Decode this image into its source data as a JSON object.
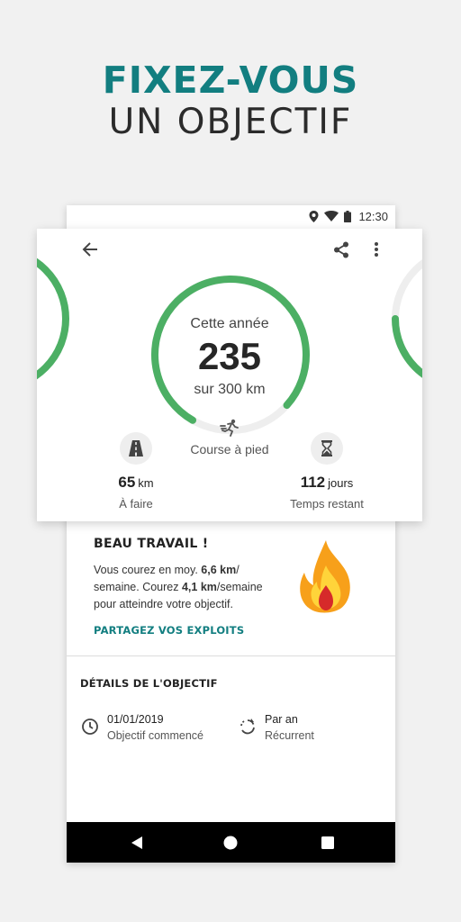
{
  "promo": {
    "line1": "FIXEZ-VOUS",
    "line2": "UN OBJECTIF"
  },
  "status_bar": {
    "time": "12:30",
    "icons": [
      "location-icon",
      "wifi-icon",
      "battery-icon"
    ]
  },
  "toolbar": {
    "back_icon": "arrow-back-icon",
    "share_icon": "share-icon",
    "more_icon": "more-vertical-icon"
  },
  "goal": {
    "period_label": "Cette année",
    "current": "235",
    "target_label": "sur 300 km",
    "progress": 0.783,
    "activity_icon": "running-icon",
    "activity_label": "Course à pied",
    "accent_color": "#4caf64"
  },
  "stats": {
    "remaining": {
      "icon": "road-icon",
      "value": "65",
      "unit": "km",
      "label": "À faire"
    },
    "time_left": {
      "icon": "hourglass-icon",
      "value": "112",
      "unit": "jours",
      "label": "Temps restant"
    }
  },
  "encouragement": {
    "title": "BEAU TRAVAIL !",
    "text_1": "Vous courez en moy. ",
    "avg": "6,6 km",
    "text_2": "/ semaine. Courez ",
    "needed": "4,1 km",
    "text_3": "/semaine pour atteindre votre objectif.",
    "share_link": "PARTAGEZ VOS EXPLOITS",
    "flame_icon": "flame-icon"
  },
  "details": {
    "title": "DÉTAILS DE L'OBJECTIF",
    "start": {
      "icon": "clock-icon",
      "value": "01/01/2019",
      "label": "Objectif commencé"
    },
    "recurrence": {
      "icon": "repeat-icon",
      "value": "Par an",
      "label": "Récurrent"
    }
  },
  "nav": {
    "back": "nav-back-icon",
    "home": "nav-home-icon",
    "recents": "nav-recents-icon"
  }
}
